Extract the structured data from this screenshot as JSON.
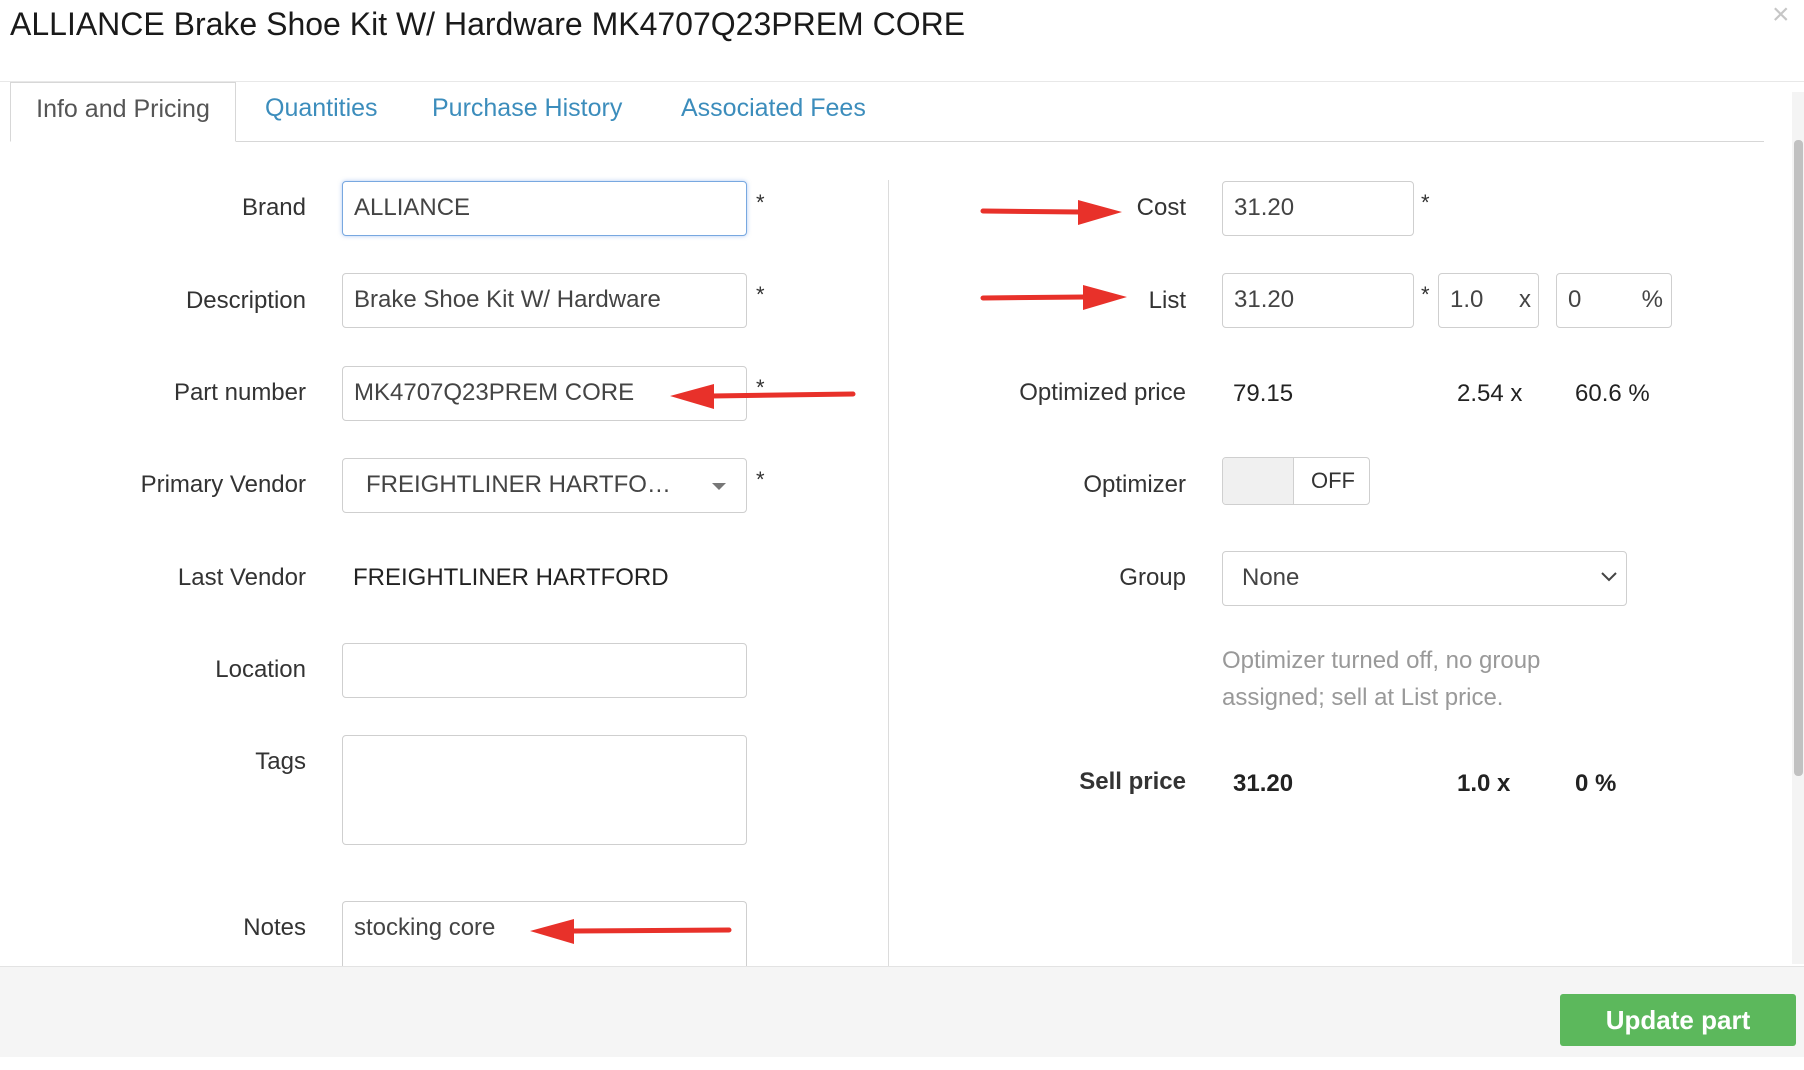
{
  "dialog": {
    "title": "ALLIANCE Brake Shoe Kit W/ Hardware MK4707Q23PREM CORE",
    "close_glyph": "×"
  },
  "tabs": [
    {
      "label": "Info and Pricing"
    },
    {
      "label": "Quantities"
    },
    {
      "label": "Purchase History"
    },
    {
      "label": "Associated Fees"
    }
  ],
  "left": {
    "brand": {
      "label": "Brand",
      "value": "ALLIANCE"
    },
    "description": {
      "label": "Description",
      "value": "Brake Shoe Kit W/ Hardware"
    },
    "part_number": {
      "label": "Part number",
      "value": "MK4707Q23PREM CORE"
    },
    "primary_vendor": {
      "label": "Primary Vendor",
      "value": "FREIGHTLINER HARTFO…"
    },
    "last_vendor": {
      "label": "Last Vendor",
      "value": "FREIGHTLINER HARTFORD"
    },
    "location": {
      "label": "Location",
      "value": ""
    },
    "tags": {
      "label": "Tags",
      "value": ""
    },
    "notes": {
      "label": "Notes",
      "value": "stocking core"
    },
    "required_mark": "*"
  },
  "right": {
    "cost": {
      "label": "Cost",
      "value": "31.20"
    },
    "list": {
      "label": "List",
      "value": "31.20",
      "multiplier": "1.0",
      "multiplier_unit": "x",
      "margin": "0",
      "margin_unit": "%"
    },
    "optimized_price": {
      "label": "Optimized price",
      "price": "79.15",
      "multiplier": "2.54 x",
      "margin": "60.6 %"
    },
    "optimizer": {
      "label": "Optimizer",
      "state": "OFF"
    },
    "group": {
      "label": "Group",
      "value": "None"
    },
    "help_text": "Optimizer turned off, no group assigned; sell at List price.",
    "sell_price": {
      "label": "Sell price",
      "price": "31.20",
      "multiplier": "1.0 x",
      "margin": "0 %"
    },
    "required_mark": "*"
  },
  "footer": {
    "update_button": "Update part"
  },
  "colors": {
    "link": "#3c8dbc",
    "success": "#5cb85c",
    "annotation_arrow": "#e8312a"
  }
}
